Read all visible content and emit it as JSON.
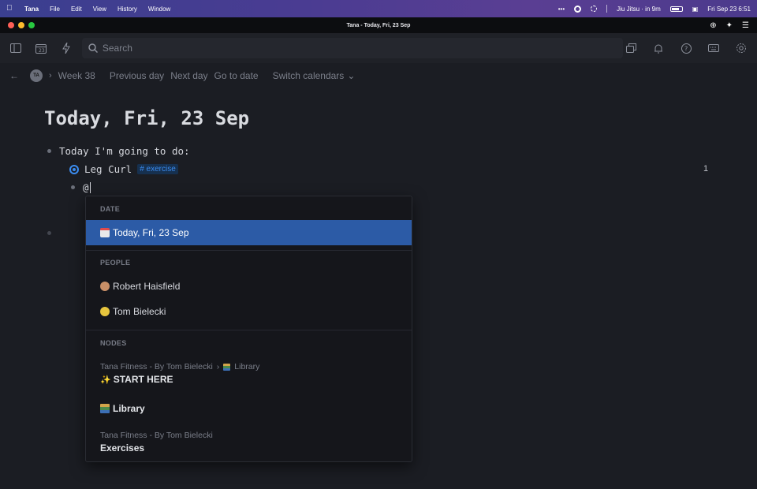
{
  "menubar": {
    "app": "Tana",
    "menus": [
      "File",
      "Edit",
      "View",
      "History",
      "Window"
    ],
    "event": "Jiu Jitsu · in 9m",
    "datetime": "Fri Sep 23  6:51"
  },
  "window": {
    "title": "Tana - Today, Fri, 23 Sep"
  },
  "toolbar": {
    "search_placeholder": "Search"
  },
  "nav": {
    "avatar": "TA",
    "week": "Week 38",
    "previous": "Previous day",
    "next": "Next day",
    "goto": "Go to date",
    "switch": "Switch calendars"
  },
  "page": {
    "title": "Today, Fri, 23 Sep",
    "nodes": [
      {
        "text": "Today I'm going to do:"
      },
      {
        "text": "Leg Curl",
        "tag": "# exercise",
        "count": "1"
      },
      {
        "text": "@"
      }
    ]
  },
  "dropdown": {
    "date_label": "DATE",
    "date_item": "Today, Fri, 23 Sep",
    "people_label": "PEOPLE",
    "people": [
      "Robert Haisfield",
      "Tom Bielecki"
    ],
    "nodes_label": "NODES",
    "node1_path_a": "Tana Fitness - By Tom Bielecki",
    "node1_path_b": "Library",
    "node1_title": "START HERE",
    "node2_title": "Library",
    "node3_path": "Tana Fitness - By Tom Bielecki",
    "node3_title": "Exercises"
  },
  "colors": {
    "accent": "#3b8cf0",
    "selection": "#2c5ba6",
    "background": "#1b1d23"
  }
}
